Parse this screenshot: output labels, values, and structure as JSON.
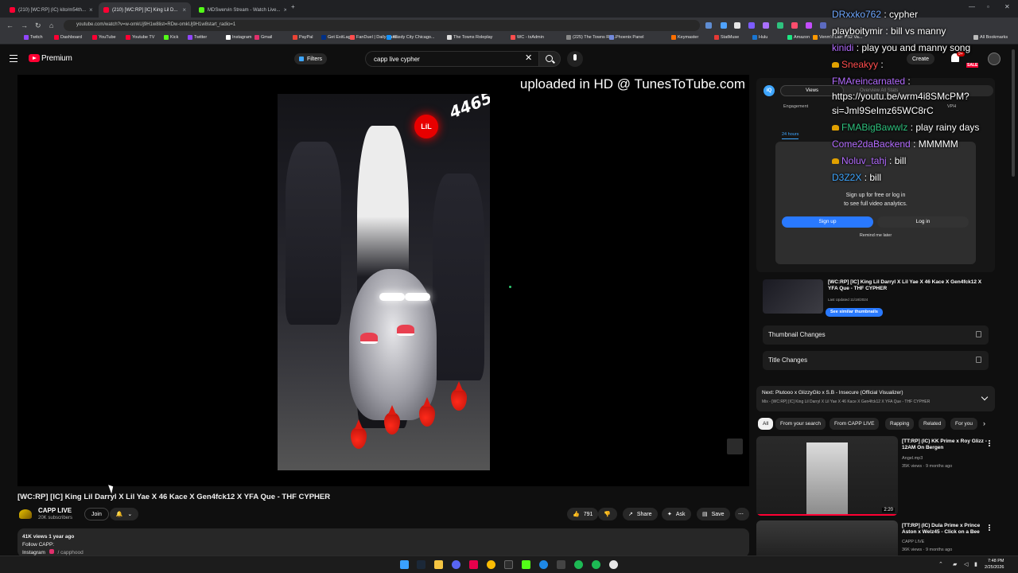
{
  "browser": {
    "tabs": [
      {
        "label": "(210) [WC:RP] (IC) kito/m54th..."
      },
      {
        "label": "(210) [WC:RP] [IC] King Lil D..."
      },
      {
        "label": "MDSwervin Stream - Watch Live..."
      }
    ],
    "url": "youtube.com/watch?v=w-omkUj9H1w8list=RDw-omkUj9H1w8start_radio=1",
    "bookmarks": [
      "Twitch",
      "Dashboard",
      "YouTube",
      "Youtube TV",
      "Kick",
      "Twitter",
      "Instagram",
      "Gmail",
      "PayPal",
      "Get ExitLag",
      "FanDuel | Daily Fant...",
      "Windy City Chicago...",
      "The Towns Roleplay",
      "WC - txAdmin",
      "(225) The Towns Rol...",
      "Phoenix Panel",
      "Keymaster",
      "StatMuse",
      "Hulu",
      "Amazon",
      "Venm's Lair: PS2 Va..."
    ],
    "all_bookmarks": "All Bookmarks"
  },
  "header": {
    "brand": "Premium",
    "filters_label": "Filters",
    "search_value": "capp live cypher",
    "create_label": "Create",
    "notif_count": "9+",
    "sale_label": "SALE"
  },
  "player": {
    "watermark": "uploaded in HD @ TunesToTube.com",
    "overlay_number": "4465",
    "logo_text": "LiL"
  },
  "video": {
    "title": "[WC:RP] [IC] King Lil Darryl X Lil Yae X 46 Kace X Gen4fck12 X YFA Que - THF CYPHER",
    "channel": "CAPP LIVE",
    "subscribers": "20K subscribers",
    "join_label": "Join",
    "likes": "791",
    "share_label": "Share",
    "ask_label": "Ask",
    "save_label": "Save",
    "views_date": "41K views  1 year ago",
    "desc_line1": "Follow CAPP:",
    "desc_line2": "Instagram",
    "desc_handle": "/ capphood"
  },
  "analytics": {
    "logo": "iQ",
    "tab_active": "Views",
    "tab_dim": "Overview      All Stats",
    "engagement": "Engagement",
    "vph": "VPH",
    "hours24": "24 hours",
    "signup_text_1": "Sign up for free or log in",
    "signup_text_2": "to see full video analytics.",
    "signup_btn": "Sign up",
    "login_btn": "Log in",
    "remind": "Remind me later",
    "latest_title": "[WC:RP] [IC] King Lil Darryl X Lil Yae X 46 Kace X Gen4fck12 X YFA Que - THF CYPHER",
    "latest_updated": "Last Updated 11/18/2024",
    "similar_btn": "See similar thumbnails",
    "thumbnail_changes": "Thumbnail Changes",
    "title_changes": "Title Changes"
  },
  "next": {
    "title": "Next: Plutooo x GlizzyGlo x S.B - Insecure (Official Visualizer)",
    "sub": "Mix - [WC:RP] [IC] King Lil Darryl X Lil Yae X 46 Kace X Gen4fck12 X YFA Que - THF CYPHER"
  },
  "chips": [
    "All",
    "From your search",
    "From CAPP LIVE",
    "Rapping",
    "Related",
    "For you"
  ],
  "related": [
    {
      "title": "[TT:RP] (IC) KK Prime x Roy Glizz - 12AM On Bergen",
      "channel": "Angel.mp3",
      "meta": "35K views · 9 months ago",
      "duration": "2:20"
    },
    {
      "title": "[TT:RP] (IC) Dula Prime x Prince Aston x Welz45 - Click on a Bee",
      "channel": "CAPP LIVE",
      "meta": "36K views · 9 months ago"
    }
  ],
  "chat": [
    {
      "user": "DRxxko762",
      "color": "#6fa8ff",
      "msg": "cypher",
      "badge": false
    },
    {
      "user": "playboitymir",
      "color": "#ffffff",
      "msg": "bill vs manny",
      "badge": false
    },
    {
      "user": "kinidi",
      "color": "#b36bff",
      "msg": "play you and manny song",
      "badge": false
    },
    {
      "user": "Sneakyy",
      "color": "#ff4d4d",
      "msg": "",
      "badge": true
    },
    {
      "user": "FMAreincarnated",
      "color": "#b36bff",
      "msg": "",
      "badge": false
    },
    {
      "user": "",
      "color": "#ffffff",
      "msg": "https://youtu.be/wrm4i8SMcPM?",
      "badge": false
    },
    {
      "user": "",
      "color": "#ffffff",
      "msg": "si=Jml9SeImz65WC8rC",
      "badge": false
    },
    {
      "user": "FMABigBawwlz",
      "color": "#2ec27e",
      "msg": "play rainy days",
      "badge": true
    },
    {
      "user": "Come2daBackend",
      "color": "#b36bff",
      "msg": "MMMMM",
      "badge": false
    },
    {
      "user": "Noluv_tahj",
      "color": "#b36bff",
      "msg": "bill",
      "badge": true
    },
    {
      "user": "D3Z2X",
      "color": "#3ea6ff",
      "msg": "bill",
      "badge": false
    }
  ],
  "taskbar": {
    "time": "7:48 PM",
    "date": "2/25/2026"
  },
  "colors": {
    "yt_red": "#ff0033",
    "accent_blue": "#2979ff",
    "bg": "#0f0f0f"
  }
}
